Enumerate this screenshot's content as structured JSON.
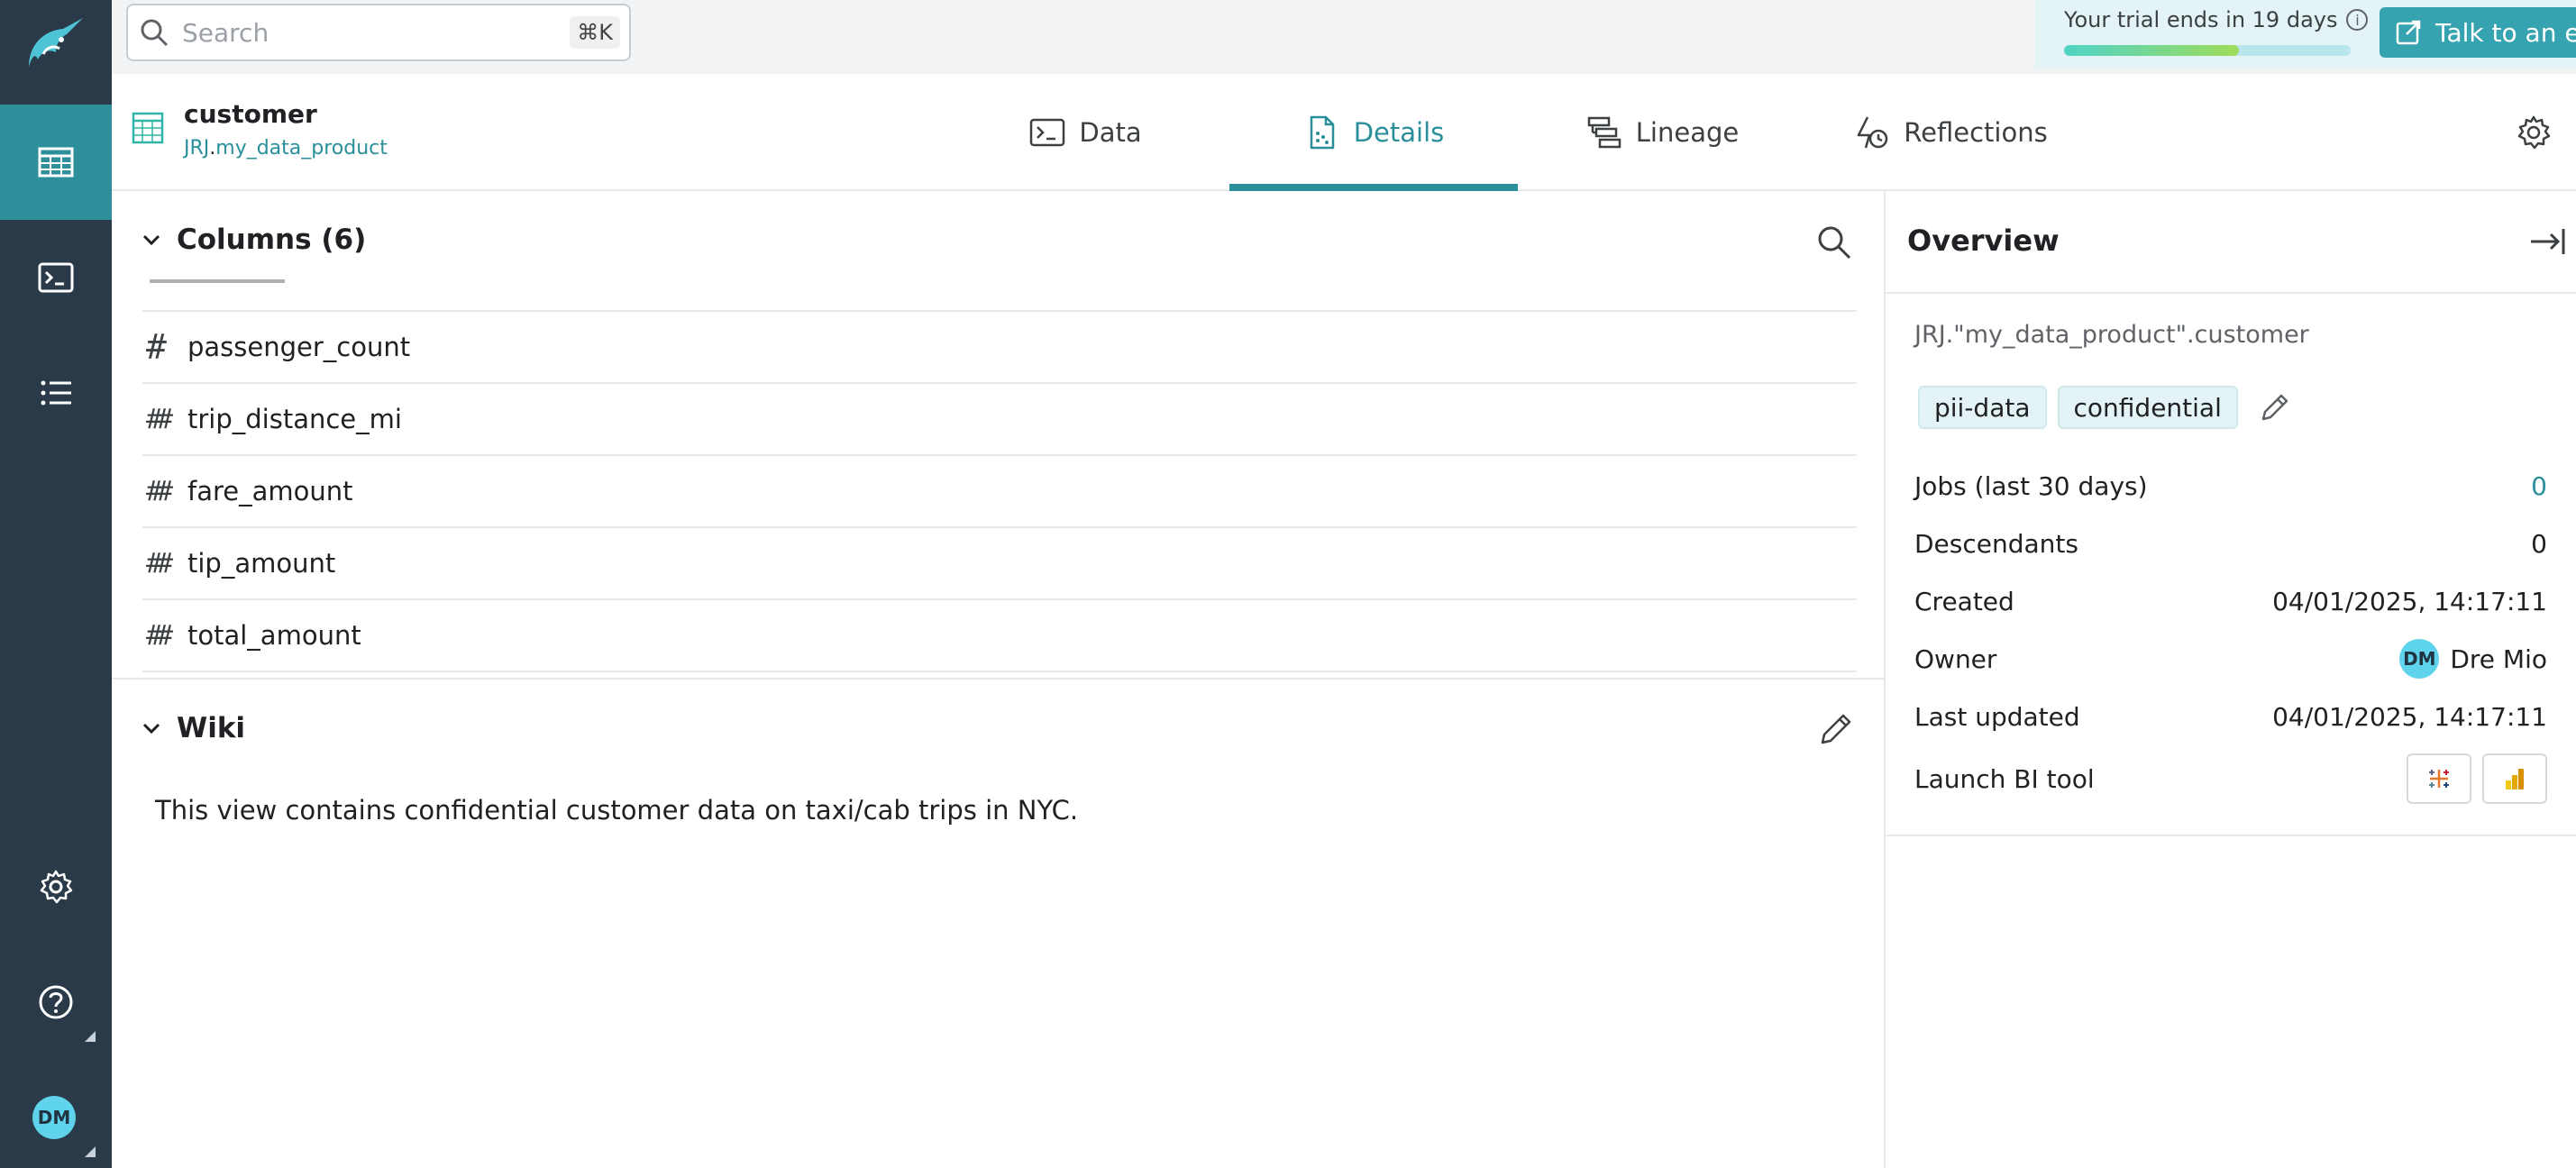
{
  "search": {
    "placeholder": "Search",
    "shortcut": "⌘K"
  },
  "trial": {
    "text": "Your trial ends in 19 days",
    "progress": 0.61,
    "cta": "Talk to an expert"
  },
  "dataset": {
    "name": "customer",
    "space": "JRJ",
    "folder": "my_data_product"
  },
  "tabs": [
    {
      "label": "Data",
      "icon": "terminal-icon"
    },
    {
      "label": "Details",
      "icon": "document-icon",
      "active": true
    },
    {
      "label": "Lineage",
      "icon": "lineage-icon"
    },
    {
      "label": "Reflections",
      "icon": "reflections-icon"
    }
  ],
  "columns": {
    "title": "Columns (6)",
    "rows": [
      {
        "type": "#",
        "name": "passenger_count"
      },
      {
        "type": "##",
        "name": "trip_distance_mi"
      },
      {
        "type": "##",
        "name": "fare_amount"
      },
      {
        "type": "##",
        "name": "tip_amount"
      },
      {
        "type": "##",
        "name": "total_amount"
      }
    ]
  },
  "wiki": {
    "title": "Wiki",
    "text": "This view contains confidential customer data on taxi/cab trips in NYC."
  },
  "overview": {
    "title": "Overview",
    "path": "JRJ.\"my_data_product\".customer",
    "tags": [
      "pii-data",
      "confidential"
    ],
    "jobs_label": "Jobs (last 30 days)",
    "jobs_value": "0",
    "descendants_label": "Descendants",
    "descendants_value": "0",
    "created_label": "Created",
    "created_value": "04/01/2025, 14:17:11",
    "owner_label": "Owner",
    "owner_initials": "DM",
    "owner_name": "Dre Mio",
    "updated_label": "Last updated",
    "updated_value": "04/01/2025, 14:17:11",
    "bi_label": "Launch BI tool"
  },
  "user": {
    "initials": "DM"
  },
  "colors": {
    "accent": "#2a8f9a",
    "rail": "#2a3a48",
    "button": "#35a3b0"
  }
}
